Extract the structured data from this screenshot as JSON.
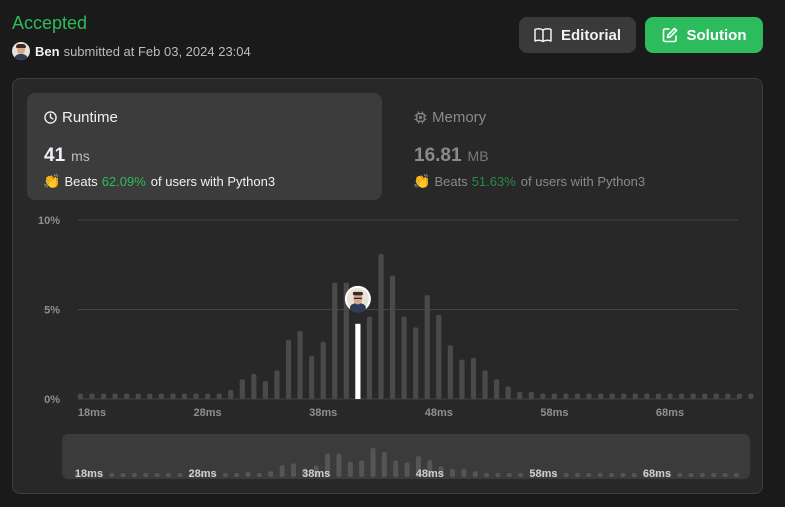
{
  "header": {
    "status": "Accepted",
    "submitter_name": "Ben",
    "submitted_text": "submitted at Feb 03, 2024 23:04",
    "editorial_label": "Editorial",
    "solution_label": "Solution"
  },
  "runtime_card": {
    "title": "Runtime",
    "value": "41",
    "unit": "ms",
    "beats_label": "Beats",
    "beats_pct": "62.09%",
    "beats_suffix": "of users with Python3"
  },
  "memory_card": {
    "title": "Memory",
    "value": "16.81",
    "unit": "MB",
    "beats_label": "Beats",
    "beats_pct": "51.63%",
    "beats_suffix": "of users with Python3"
  },
  "colors": {
    "accent_green": "#2cbb5d",
    "bar_gray": "#4a4a4a",
    "bar_highlight": "#ffffff"
  },
  "icons": {
    "editorial": "book-icon",
    "solution": "edit-icon",
    "runtime": "clock-icon",
    "memory": "chip-icon",
    "beats": "clapping-hands-icon"
  },
  "chart_data": {
    "type": "bar",
    "xlabel": "",
    "ylabel": "",
    "y_ticks": [
      "10%",
      "5%",
      "0%"
    ],
    "x_ticks": [
      "18ms",
      "28ms",
      "38ms",
      "48ms",
      "58ms",
      "68ms"
    ],
    "x_tick_values": [
      18,
      28,
      38,
      48,
      58,
      68
    ],
    "ylim": [
      0,
      10
    ],
    "grid": true,
    "x": [
      17,
      18,
      19,
      20,
      21,
      22,
      23,
      24,
      25,
      26,
      27,
      28,
      29,
      30,
      31,
      32,
      33,
      34,
      35,
      36,
      37,
      38,
      39,
      40,
      41,
      42,
      43,
      44,
      45,
      46,
      47,
      48,
      49,
      50,
      51,
      52,
      53,
      54,
      55,
      56,
      57,
      58,
      59,
      60,
      61,
      62,
      63,
      64,
      65,
      66,
      67,
      68,
      69,
      70,
      71,
      72,
      73,
      74,
      75
    ],
    "values": [
      0.3,
      0.3,
      0.3,
      0.3,
      0.3,
      0.3,
      0.3,
      0.3,
      0.3,
      0.3,
      0.3,
      0.3,
      0.3,
      0.5,
      1.1,
      1.4,
      1.0,
      1.6,
      3.3,
      3.8,
      2.4,
      3.2,
      6.5,
      6.5,
      4.2,
      4.6,
      8.1,
      6.9,
      4.6,
      4.0,
      5.8,
      4.7,
      3.0,
      2.2,
      2.3,
      1.6,
      1.1,
      0.7,
      0.4,
      0.4,
      0.3,
      0.3,
      0.3,
      0.3,
      0.3,
      0.3,
      0.3,
      0.3,
      0.3,
      0.3,
      0.3,
      0.3,
      0.3,
      0.3,
      0.3,
      0.3,
      0.3,
      0.3,
      0.3
    ],
    "highlight_x": 41
  }
}
